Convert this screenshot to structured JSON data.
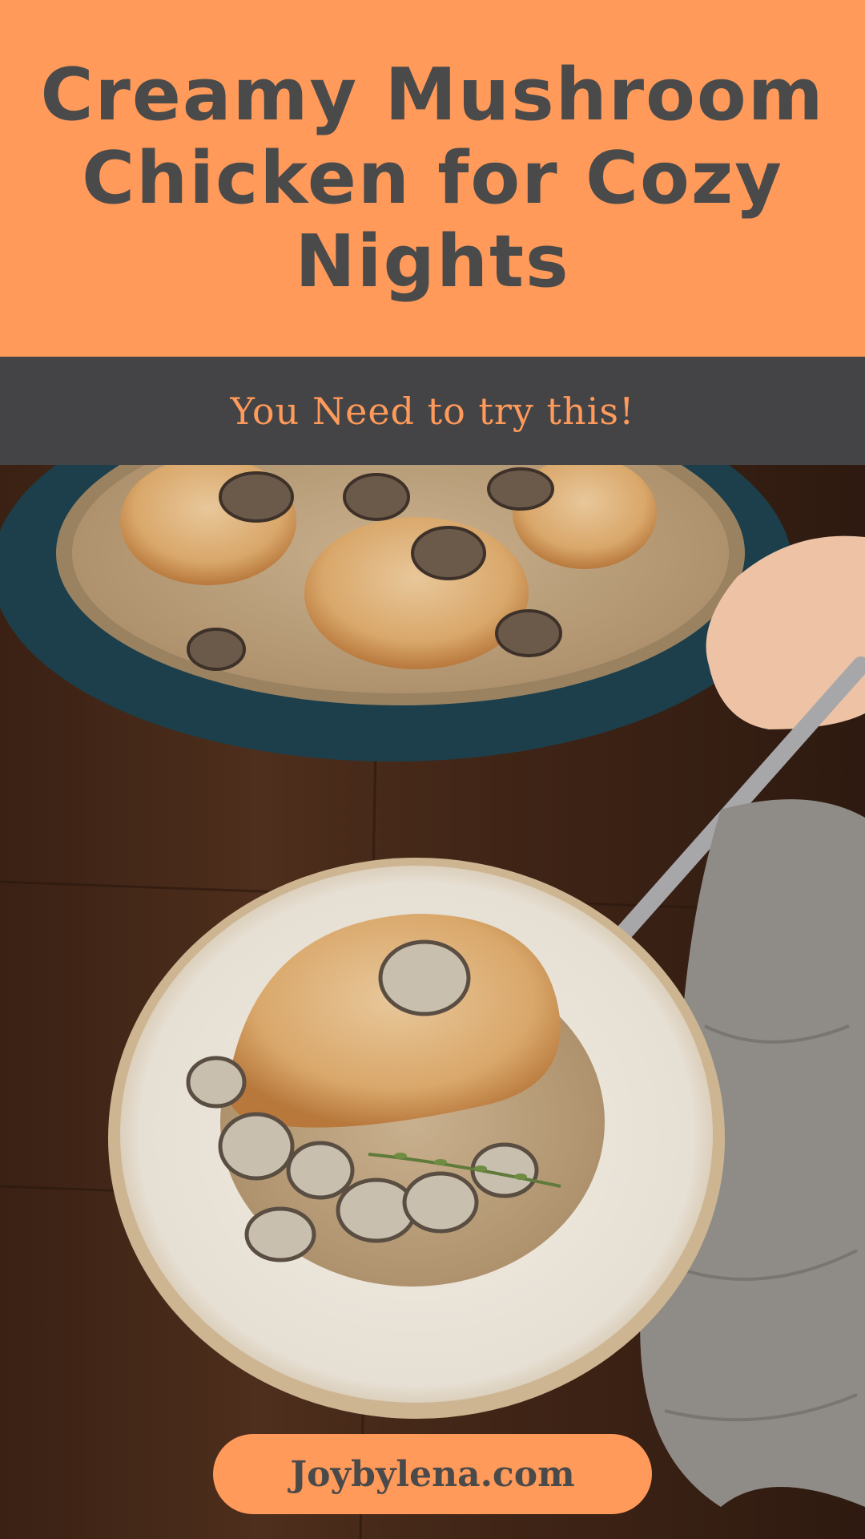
{
  "header": {
    "title": "Creamy Mushroom Chicken for Cozy Nights",
    "background_color": "#ff9a5a",
    "text_color": "#4a4a4a"
  },
  "subbar": {
    "text": "You Need to try this!",
    "background_color": "#444446",
    "text_color": "#ff9a5a"
  },
  "photo": {
    "subject": "creamy mushroom chicken in skillet and on plate"
  },
  "footer": {
    "site": "Joybylena.com"
  }
}
